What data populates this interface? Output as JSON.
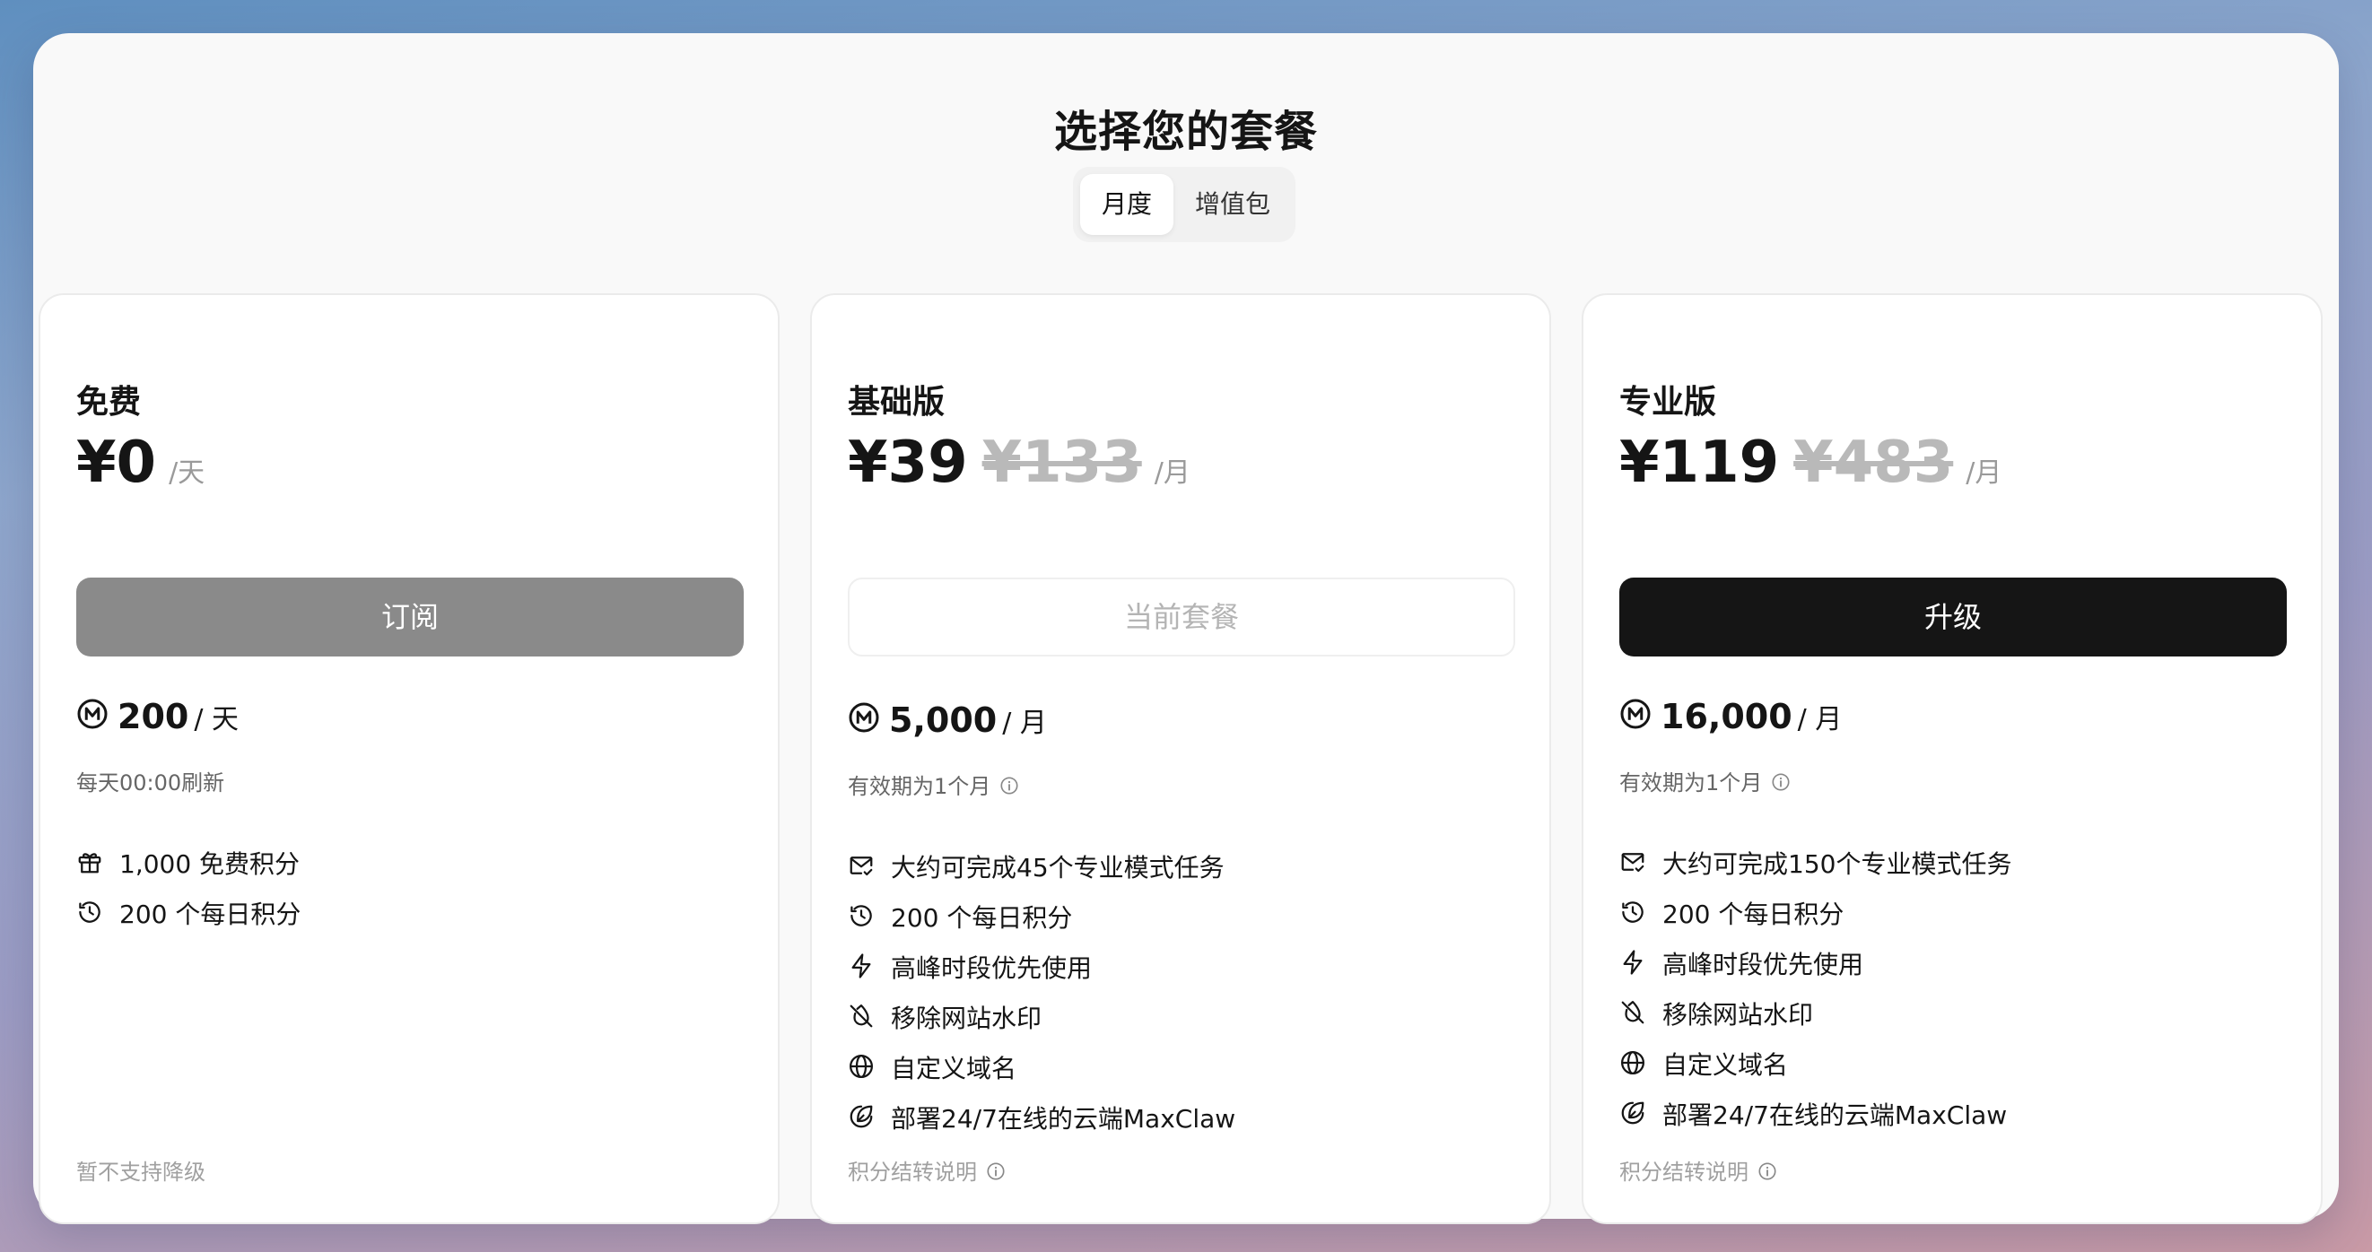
{
  "page": {
    "title": "选择您的套餐"
  },
  "tabs": [
    {
      "label": "月度",
      "active": true
    },
    {
      "label": "增值包",
      "active": false
    }
  ],
  "plans": [
    {
      "name": "免费",
      "price": "¥0",
      "original_price": "",
      "period": "/天",
      "button": {
        "label": "订阅",
        "style": "gray"
      },
      "credits": {
        "amount": "200",
        "unit": "/ 天",
        "note": "每天00:00刷新"
      },
      "features": [
        {
          "icon": "gift-icon",
          "text": "1,000 免费积分"
        },
        {
          "icon": "history-icon",
          "text": "200 个每日积分"
        }
      ],
      "footer": "暂不支持降级"
    },
    {
      "name": "基础版",
      "price": "¥39",
      "original_price": "¥133",
      "period": "/月",
      "button": {
        "label": "当前套餐",
        "style": "outline"
      },
      "credits": {
        "amount": "5,000",
        "unit": "/ 月",
        "note": "有效期为1个月"
      },
      "features": [
        {
          "icon": "mail-check-icon",
          "text": "大约可完成45个专业模式任务"
        },
        {
          "icon": "history-icon",
          "text": "200 个每日积分"
        },
        {
          "icon": "lightning-icon",
          "text": "高峰时段优先使用"
        },
        {
          "icon": "no-watermark-icon",
          "text": "移除网站水印"
        },
        {
          "icon": "globe-icon",
          "text": "自定义域名"
        },
        {
          "icon": "cloud-deploy-icon",
          "text": "部署24/7在线的云端MaxClaw"
        }
      ],
      "footer": "积分结转说明"
    },
    {
      "name": "专业版",
      "price": "¥119",
      "original_price": "¥483",
      "period": "/月",
      "button": {
        "label": "升级",
        "style": "black"
      },
      "credits": {
        "amount": "16,000",
        "unit": "/ 月",
        "note": "有效期为1个月"
      },
      "features": [
        {
          "icon": "mail-check-icon",
          "text": "大约可完成150个专业模式任务"
        },
        {
          "icon": "history-icon",
          "text": "200 个每日积分"
        },
        {
          "icon": "lightning-icon",
          "text": "高峰时段优先使用"
        },
        {
          "icon": "no-watermark-icon",
          "text": "移除网站水印"
        },
        {
          "icon": "globe-icon",
          "text": "自定义域名"
        },
        {
          "icon": "cloud-deploy-icon",
          "text": "部署24/7在线的云端MaxClaw"
        }
      ],
      "footer": "积分结转说明"
    }
  ]
}
